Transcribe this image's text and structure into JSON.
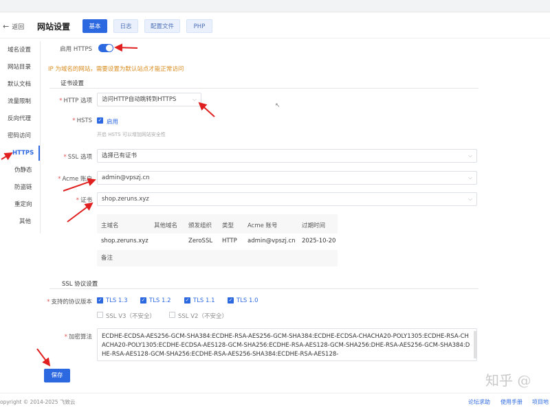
{
  "header": {
    "back_label": "返回",
    "title": "网站设置",
    "tabs": [
      {
        "label": "基本",
        "active": true
      },
      {
        "label": "日志",
        "active": false
      },
      {
        "label": "配置文件",
        "active": false
      },
      {
        "label": "PHP",
        "active": false
      }
    ]
  },
  "sidebar": {
    "items": [
      {
        "label": "域名设置"
      },
      {
        "label": "网站目录"
      },
      {
        "label": "默认文档"
      },
      {
        "label": "流量限制"
      },
      {
        "label": "反向代理"
      },
      {
        "label": "密码访问"
      },
      {
        "label": "HTTPS",
        "active": true
      },
      {
        "label": "伪静态"
      },
      {
        "label": "防盗链"
      },
      {
        "label": "重定向"
      },
      {
        "label": "其他"
      }
    ]
  },
  "form": {
    "enable_https_label": "启用 HTTPS",
    "enable_https_on": true,
    "ip_warning": "IP 为域名的网站，需要设置为默认站点才能正常访问",
    "cert_section": "证书设置",
    "http_option_label": "HTTP 选项",
    "http_option_value": "访问HTTP自动跳转到HTTPS",
    "hsts_label": "HSTS",
    "hsts_checkbox_label": "启用",
    "hsts_hint": "开启 HSTS 可以增加网站安全性",
    "ssl_option_label": "SSL 选项",
    "ssl_option_value": "选择已有证书",
    "acme_label": "Acme 账户",
    "acme_value": "admin@vpszj.cn",
    "cert_label": "证书",
    "cert_value": "shop.zeruns.xyz",
    "cert_table": {
      "headers": [
        "主域名",
        "其他域名",
        "颁发组织",
        "类型",
        "Acme 账号",
        "过期时间"
      ],
      "row": [
        "shop.zeruns.xyz",
        "",
        "ZeroSSL",
        "HTTP",
        "admin@vpszj.cn",
        "2025-10-20"
      ],
      "note_label": "备注"
    },
    "ssl_section": "SSL 协议设置",
    "protocols_label": "支持的协议版本",
    "protocols": [
      {
        "label": "TLS 1.3",
        "checked": true
      },
      {
        "label": "TLS 1.2",
        "checked": true
      },
      {
        "label": "TLS 1.1",
        "checked": true
      },
      {
        "label": "TLS 1.0",
        "checked": true
      },
      {
        "label": "SSL V3（不安全）",
        "checked": false
      },
      {
        "label": "SSL V2（不安全）",
        "checked": false
      }
    ],
    "cipher_label": "加密算法",
    "cipher_value": "ECDHE-ECDSA-AES256-GCM-SHA384:ECDHE-RSA-AES256-GCM-SHA384:ECDHE-ECDSA-CHACHA20-POLY1305:ECDHE-RSA-CHACHA20-POLY1305:ECDHE-ECDSA-AES128-GCM-SHA256:ECDHE-RSA-AES128-GCM-SHA256:DHE-RSA-AES256-GCM-SHA384:DHE-RSA-AES128-GCM-SHA256:ECDHE-RSA-AES256-SHA384:ECDHE-RSA-AES128-",
    "save_label": "保存"
  },
  "footer": {
    "copyright": "opyright © 2014-2025 飞致云",
    "links": [
      "论坛求助",
      "使用手册",
      "项目地"
    ]
  },
  "watermark": "知乎 @",
  "colors": {
    "accent": "#2c68e0",
    "warning": "#d98c1f",
    "annotation_arrow": "#e02020"
  }
}
